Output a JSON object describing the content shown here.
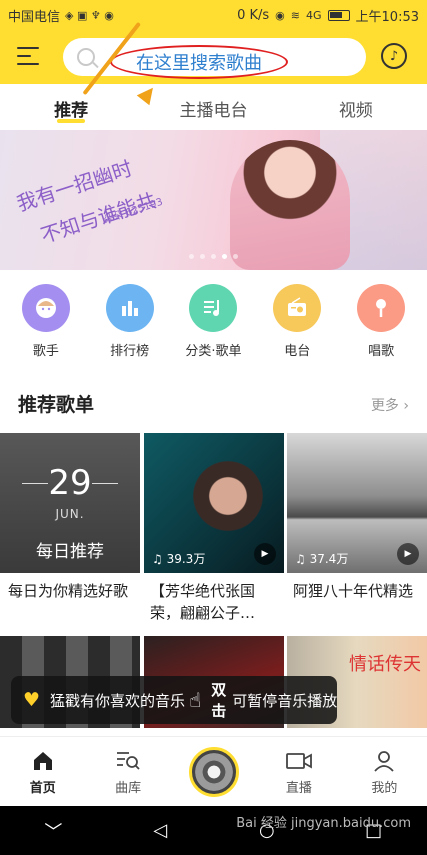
{
  "status_bar": {
    "carrier": "中国电信",
    "network_speed": "0 K/s",
    "signal": "4G",
    "time": "上午10:53"
  },
  "search": {
    "placeholder": "",
    "annotation": "在这里搜索歌曲"
  },
  "top_tabs": [
    {
      "label": "推荐",
      "active": true
    },
    {
      "label": "主播电台",
      "active": false
    },
    {
      "label": "视频",
      "active": false
    }
  ],
  "banner": {
    "line1": "我有一招幽时",
    "line2": "不知与谁能共",
    "line3": "朵朵 625193",
    "page_count": 5,
    "current_page": 4
  },
  "categories": [
    {
      "label": "歌手",
      "icon": "singer-icon"
    },
    {
      "label": "排行榜",
      "icon": "chart-icon"
    },
    {
      "label": "分类·歌单",
      "icon": "playlist-icon"
    },
    {
      "label": "电台",
      "icon": "radio-icon"
    },
    {
      "label": "唱歌",
      "icon": "microphone-icon"
    }
  ],
  "section": {
    "title": "推荐歌单",
    "more": "更多"
  },
  "playlists": [
    {
      "date": "29",
      "month": "JUN.",
      "label": "每日推荐",
      "caption": "每日为你精选好歌",
      "play_count": ""
    },
    {
      "caption": "【芳华绝代张国荣，翩翩公子…",
      "play_count": "39.3万"
    },
    {
      "caption": "阿狸八十年代精选",
      "play_count": "37.4万"
    }
  ],
  "playlists_row2_thumb_text": "情话传天",
  "toast": {
    "message": "猛戳有你喜欢的音乐",
    "action": "双击",
    "hint": "可暂停音乐播放"
  },
  "bottom_nav": [
    {
      "label": "首页",
      "icon": "home-icon",
      "active": true
    },
    {
      "label": "曲库",
      "icon": "library-icon",
      "active": false
    },
    {
      "label": "",
      "icon": "now-playing-disc",
      "active": false
    },
    {
      "label": "直播",
      "icon": "live-icon",
      "active": false
    },
    {
      "label": "我的",
      "icon": "profile-icon",
      "active": false
    }
  ],
  "watermark": "Bai 经验 jingyan.baidu.com",
  "colors": {
    "brand_yellow": "#ffde31",
    "annotation_red": "#e02020",
    "annotation_blue": "#2f7fcf"
  }
}
